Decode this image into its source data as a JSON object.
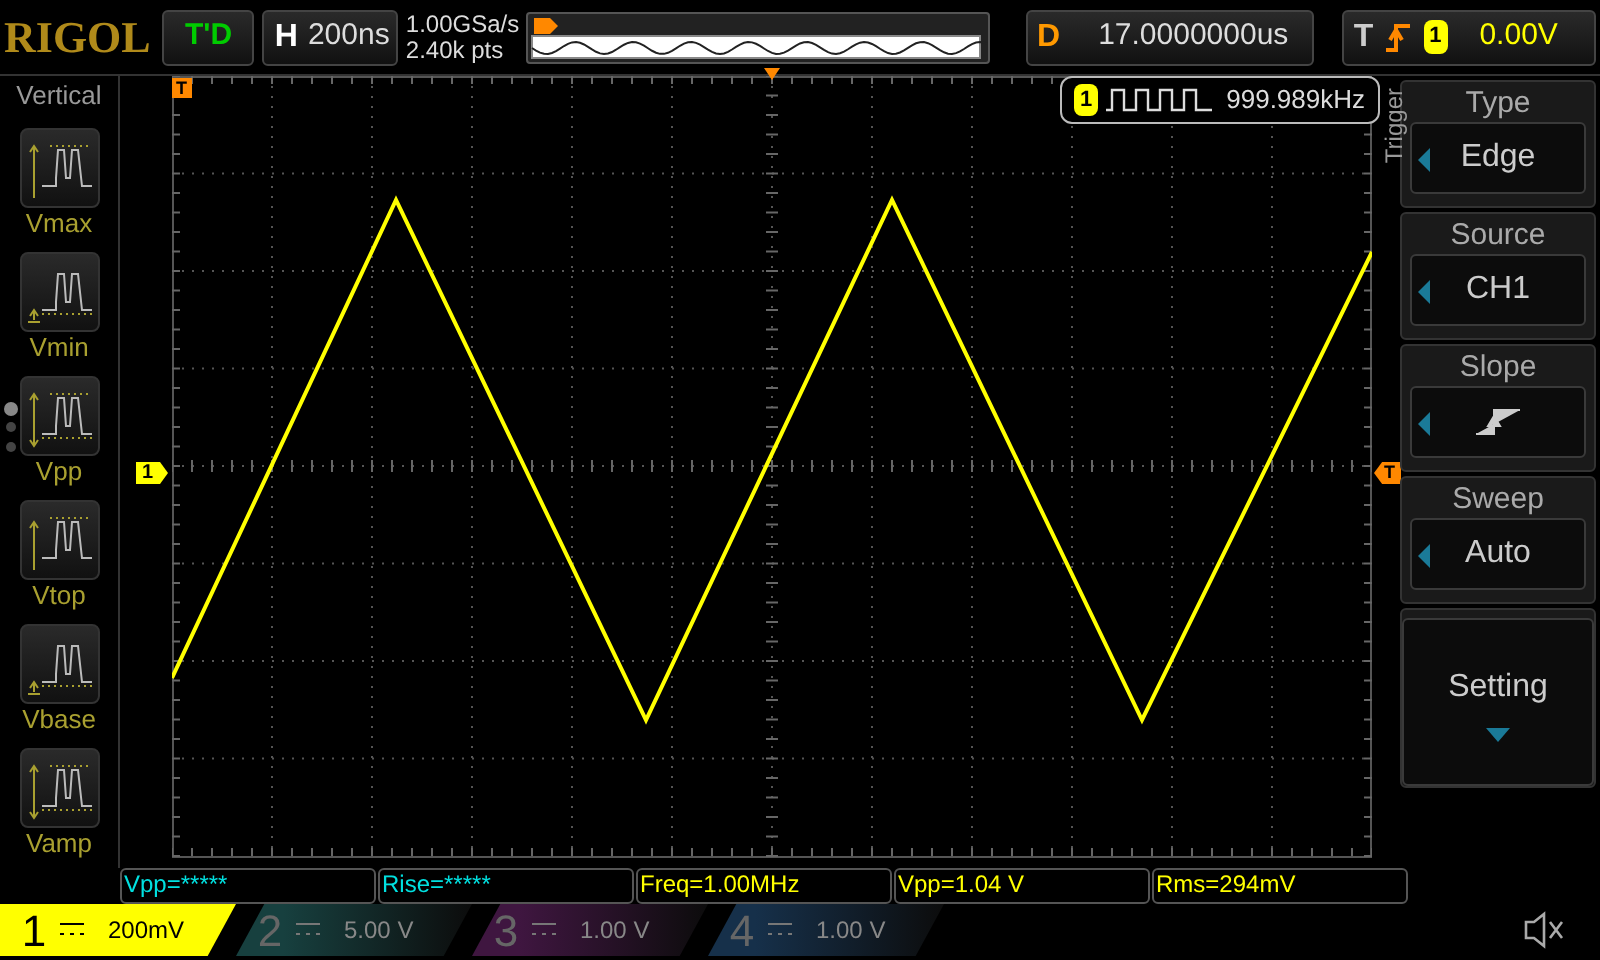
{
  "header": {
    "logo": "RIGOL",
    "run_status": "T'D",
    "horizontal": {
      "label": "H",
      "value": "200ns"
    },
    "sample_rate": "1.00GSa/s",
    "memory_depth": "2.40k pts",
    "delay": {
      "label": "D",
      "value": "17.0000000us"
    },
    "trigger": {
      "label": "T",
      "source": "1",
      "level": "0.00V"
    }
  },
  "left_menu": {
    "title": "Vertical",
    "items": [
      {
        "kind": "vmax",
        "label": "Vmax"
      },
      {
        "kind": "vmin",
        "label": "Vmin"
      },
      {
        "kind": "vpp",
        "label": "Vpp"
      },
      {
        "kind": "vtop",
        "label": "Vtop"
      },
      {
        "kind": "vbase",
        "label": "Vbase"
      },
      {
        "kind": "vamp",
        "label": "Vamp"
      }
    ],
    "page_dots": [
      {
        "selected": true
      },
      {
        "selected": false
      },
      {
        "selected": false
      }
    ]
  },
  "screen": {
    "channel_marker": "1",
    "trigger_marker": "T",
    "trigger_level_marker": "T",
    "frequency": {
      "channel": "1",
      "value": "999.989kHz"
    }
  },
  "right_menu": {
    "title": "Trigger",
    "items": [
      {
        "kind": "select",
        "label": "Type",
        "value": "Edge"
      },
      {
        "kind": "select",
        "label": "Source",
        "value": "CH1"
      },
      {
        "kind": "slope",
        "label": "Slope"
      },
      {
        "kind": "select",
        "label": "Sweep",
        "value": "Auto"
      },
      {
        "kind": "submenu",
        "label": "Setting"
      }
    ]
  },
  "measurements": [
    {
      "text": "Vpp=*****",
      "color": "#00e0e0"
    },
    {
      "text": "Rise=*****",
      "color": "#00e0e0"
    },
    {
      "text": "Freq=1.00MHz",
      "color": "#ffff00"
    },
    {
      "text": "Vpp=1.04 V",
      "color": "#ffff00"
    },
    {
      "text": "Rms=294mV",
      "color": "#ffff00"
    }
  ],
  "channels": [
    {
      "number": "1",
      "scale": "200mV",
      "selected": true,
      "color": "#ffff00"
    },
    {
      "number": "2",
      "scale": "5.00 V",
      "selected": false,
      "color": "#17403f"
    },
    {
      "number": "3",
      "scale": "1.00 V",
      "selected": false,
      "color": "#3f1640"
    },
    {
      "number": "4",
      "scale": "1.00 V",
      "selected": false,
      "color": "#16304a"
    }
  ],
  "sound": {
    "muted": true
  }
}
